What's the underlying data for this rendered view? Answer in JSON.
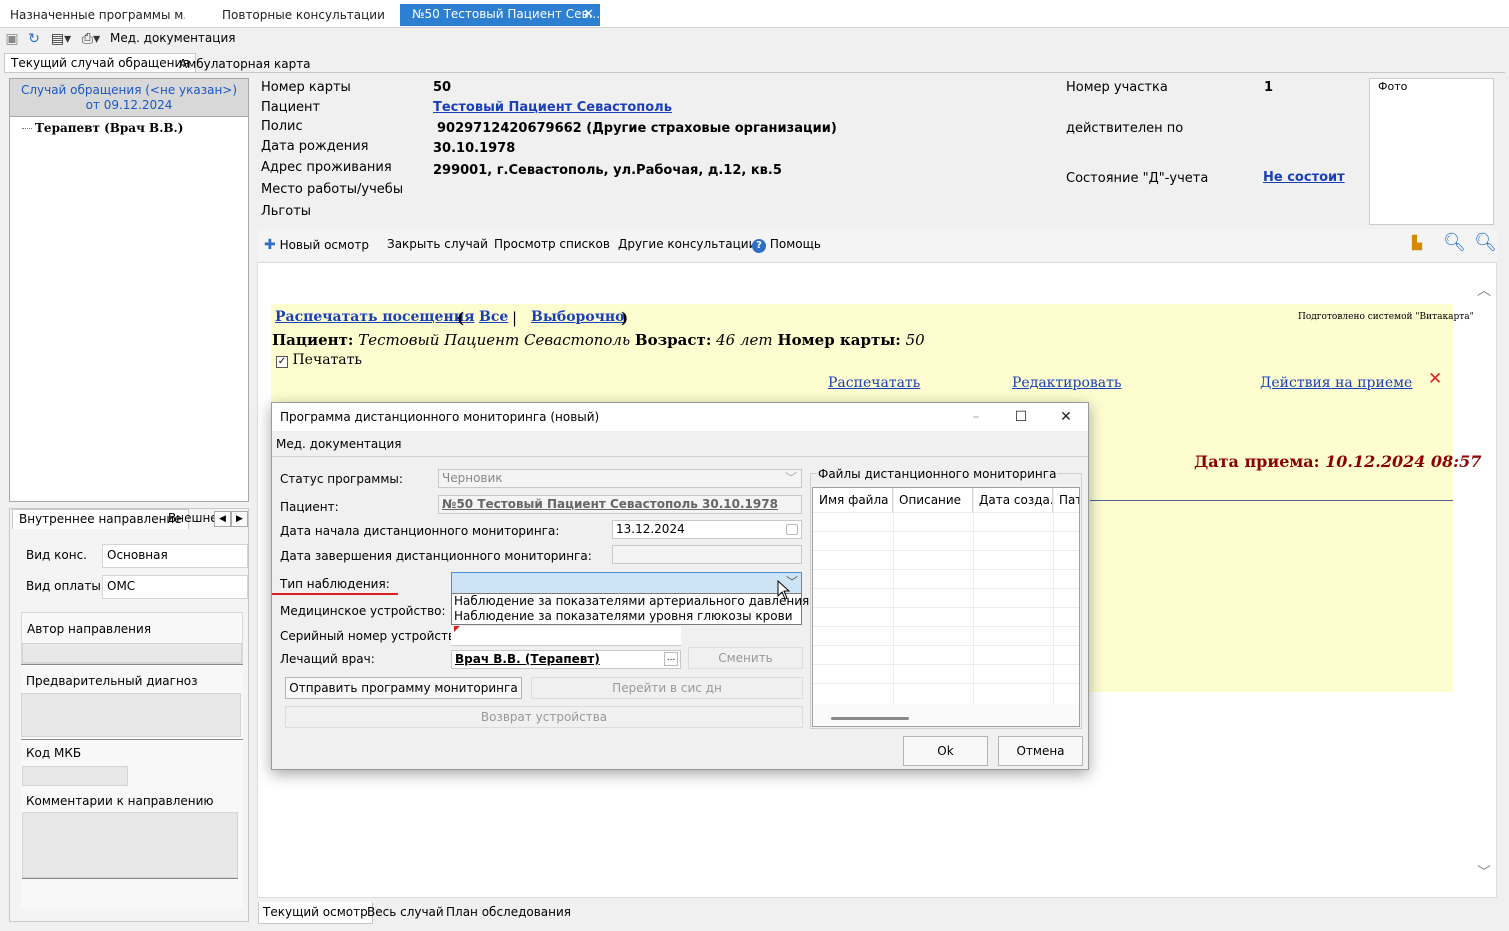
{
  "top_tabs": [
    "Назначенные программы м...",
    "Повторные консультации",
    "№50 Тестовый Пациент Сев..."
  ],
  "toolbar": {
    "med_doc_label": "Мед. документация"
  },
  "section_tabs": [
    "Текущий случай обращения",
    "Амбулаторная карта"
  ],
  "case": {
    "line1": "Случай обращения (<не указан>)",
    "line2": "от 09.12.2024"
  },
  "tree_item": "Терапевт (Врач В.В.)",
  "lower_tabs": [
    "Внутреннее направление",
    "Внешне"
  ],
  "referral": {
    "vid_kons_label": "Вид конс.",
    "vid_kons_value": "Основная",
    "vid_oplaty_label": "Вид оплаты",
    "vid_oplaty_value": "ОМС",
    "author_label": "Автор направления",
    "diag_label": "Предварительный диагноз",
    "mkb_label": "Код МКБ",
    "comments_label": "Комментарии к направлению"
  },
  "patient": {
    "card_label": "Номер карты",
    "card_value": "50",
    "patient_label": "Пациент",
    "patient_value": "Тестовый Пациент Севастополь",
    "policy_label": "Полис",
    "policy_value": "9029712420679662 (Другие страховые организации)",
    "dob_label": "Дата рождения",
    "dob_value": "30.10.1978",
    "address_label": "Адрес проживания",
    "address_value": "299001, г.Севастополь, ул.Рабочая, д.12, кв.5",
    "work_label": "Место работы/учебы",
    "benefits_label": "Льготы",
    "district_label": "Номер участка",
    "district_value": "1",
    "valid_label": "действителен по",
    "d_status_label": "Состояние \"Д\"-учета",
    "d_status_value": "Не состоит",
    "photo_label": "Фото"
  },
  "actions": {
    "new_exam": "Новый осмотр",
    "close_case": "Закрыть случай",
    "view_lists": "Просмотр списков",
    "other_consults": "Другие консультации",
    "help": "Помощь"
  },
  "visit": {
    "print_visits": "Распечатать посещения",
    "open_paren": "(",
    "all": "Все",
    "sep": "|",
    "selective": "Выборочно",
    "close_paren": ")",
    "prepared_by": "Подготовлено системой \"Витакарта\"",
    "patient_label": "Пациент:",
    "patient_name": "Тестовый Пациент Севастополь",
    "age_label": "Возраст:",
    "age_value": "46 лет",
    "card_label": "Номер карты:",
    "card_value": "50",
    "print_checkbox": "Печатать",
    "print_link": "Распечатать",
    "edit_link": "Редактировать",
    "actions_link": "Действия на приеме",
    "date_label": "Дата приема:",
    "date_value": "10.12.2024 08:57"
  },
  "bottom_tabs": [
    "Текущий осмотр",
    "Весь случай",
    "План обследования"
  ],
  "dialog": {
    "title": "Программа дистанционного мониторинга (новый)",
    "menu": "Мед. документация",
    "status_label": "Статус программы:",
    "status_value": "Черновик",
    "patient_label": "Пациент:",
    "patient_value": "№50 Тестовый Пациент Севастополь 30.10.1978",
    "start_label": "Дата начала дистанционного мониторинга:",
    "start_value": "13.12.2024",
    "end_label": "Дата завершения дистанционного мониторинга:",
    "obs_type_label": "Тип наблюдения:",
    "device_label": "Медицинское устройство:",
    "serial_label": "Серийный номер устройства:",
    "doctor_label": "Лечащий врач:",
    "doctor_value": "Врач В.В. (Терапевт)",
    "change_btn": "Сменить",
    "send_btn": "Отправить программу мониторинга",
    "goto_btn": "Перейти в сис дн",
    "return_btn": "Возврат устройства",
    "files_label": "Файлы дистанционного мониторинга",
    "grid_cols": [
      "Имя файла",
      "Описание",
      "Дата созда...",
      "Пат"
    ],
    "ok_btn": "Ok",
    "cancel_btn": "Отмена",
    "dropdown_options": [
      "Наблюдение за показателями артериального давления",
      "Наблюдение за показателями уровня глюкозы крови"
    ]
  },
  "colors": {
    "accent": "#2d7fd1",
    "link": "#1a3fb8",
    "highlight": "#fdfdd0",
    "date_red": "#8b0000",
    "underline_red": "#e02020"
  }
}
